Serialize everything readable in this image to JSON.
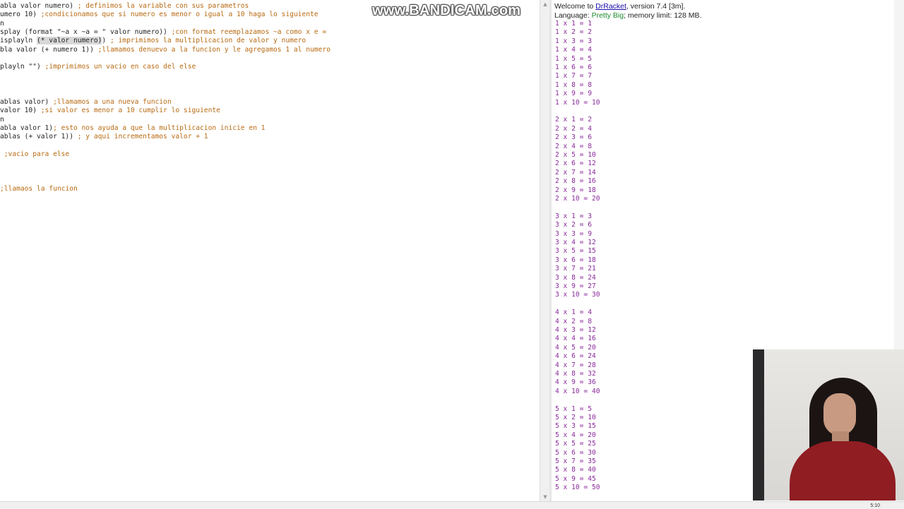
{
  "watermark": "www.BANDICAM.com",
  "editor": {
    "lines": [
      [
        {
          "t": "abla valor numero)",
          "k": "code"
        },
        {
          "t": " ; definimos la variable con sus parametros",
          "k": "comment"
        }
      ],
      [
        {
          "t": "umero 10)",
          "k": "code"
        },
        {
          "t": " ;condicionamos que si numero es menor o igual a 10 haga lo siguiente",
          "k": "comment"
        }
      ],
      [
        {
          "t": "n",
          "k": "code"
        }
      ],
      [
        {
          "t": "splay (format \"~a x ~a = \" valor numero))",
          "k": "code"
        },
        {
          "t": " ;con format reemplazamos ~a como x e =",
          "k": "comment"
        }
      ],
      [
        {
          "t": "isplayln ",
          "k": "code"
        },
        {
          "t": "(* valor numero)",
          "k": "hl"
        },
        {
          "t": ")",
          "k": "code"
        },
        {
          "t": " ; imprimimos la multiplicacion de valor y numero",
          "k": "comment"
        }
      ],
      [
        {
          "t": "bla valor (+ numero 1))",
          "k": "code"
        },
        {
          "t": " ;llamamos denuevo a la funcion y le agregamos 1 al numero",
          "k": "comment"
        }
      ],
      [],
      [
        {
          "t": "playln \"\")",
          "k": "code"
        },
        {
          "t": " ;imprimimos un vacio en caso del else",
          "k": "comment"
        }
      ],
      [],
      [],
      [],
      [
        {
          "t": "ablas valor)",
          "k": "code"
        },
        {
          "t": " ;llamamos a una nueva funcion",
          "k": "comment"
        }
      ],
      [
        {
          "t": "valor 10)",
          "k": "code"
        },
        {
          "t": " ;si valor es menor a 10 cumplir lo siguiente",
          "k": "comment"
        }
      ],
      [
        {
          "t": "n",
          "k": "code"
        }
      ],
      [
        {
          "t": "abla valor 1)",
          "k": "code"
        },
        {
          "t": "; esto nos ayuda a que la multiplicacion inicie en 1",
          "k": "comment"
        }
      ],
      [
        {
          "t": "ablas (+ valor 1))",
          "k": "code"
        },
        {
          "t": " ; y aqui incrementamos valor + 1",
          "k": "comment"
        }
      ],
      [],
      [
        {
          "t": " ;vacio para else",
          "k": "comment"
        }
      ],
      [],
      [],
      [],
      [
        {
          "t": ";llamaos la funcion",
          "k": "comment"
        }
      ]
    ]
  },
  "repl": {
    "welcome_prefix": "Welcome to ",
    "welcome_link": "DrRacket",
    "welcome_suffix": ", version 7.4 [3m].",
    "language_prefix": "Language: ",
    "language_name": "Pretty Big",
    "language_suffix": "; memory limit: 128 MB.",
    "output_lines": [
      "1 x 1 = 1",
      "1 x 2 = 2",
      "1 x 3 = 3",
      "1 x 4 = 4",
      "1 x 5 = 5",
      "1 x 6 = 6",
      "1 x 7 = 7",
      "1 x 8 = 8",
      "1 x 9 = 9",
      "1 x 10 = 10",
      "",
      "2 x 1 = 2",
      "2 x 2 = 4",
      "2 x 3 = 6",
      "2 x 4 = 8",
      "2 x 5 = 10",
      "2 x 6 = 12",
      "2 x 7 = 14",
      "2 x 8 = 16",
      "2 x 9 = 18",
      "2 x 10 = 20",
      "",
      "3 x 1 = 3",
      "3 x 2 = 6",
      "3 x 3 = 9",
      "3 x 4 = 12",
      "3 x 5 = 15",
      "3 x 6 = 18",
      "3 x 7 = 21",
      "3 x 8 = 24",
      "3 x 9 = 27",
      "3 x 10 = 30",
      "",
      "4 x 1 = 4",
      "4 x 2 = 8",
      "4 x 3 = 12",
      "4 x 4 = 16",
      "4 x 5 = 20",
      "4 x 6 = 24",
      "4 x 7 = 28",
      "4 x 8 = 32",
      "4 x 9 = 36",
      "4 x 10 = 40",
      "",
      "5 x 1 = 5",
      "5 x 2 = 10",
      "5 x 3 = 15",
      "5 x 4 = 20",
      "5 x 5 = 25",
      "5 x 6 = 30",
      "5 x 7 = 35",
      "5 x 8 = 40",
      "5 x 9 = 45",
      "5 x 10 = 50"
    ]
  },
  "scrollbar": {
    "up_icon": "▲",
    "down_icon": "▼"
  },
  "status": {
    "clock": "5:10"
  },
  "colors": {
    "comment": "#b86a12",
    "output": "#8a2a9b",
    "link": "#1a0dab",
    "language": "#1d8a2b"
  }
}
